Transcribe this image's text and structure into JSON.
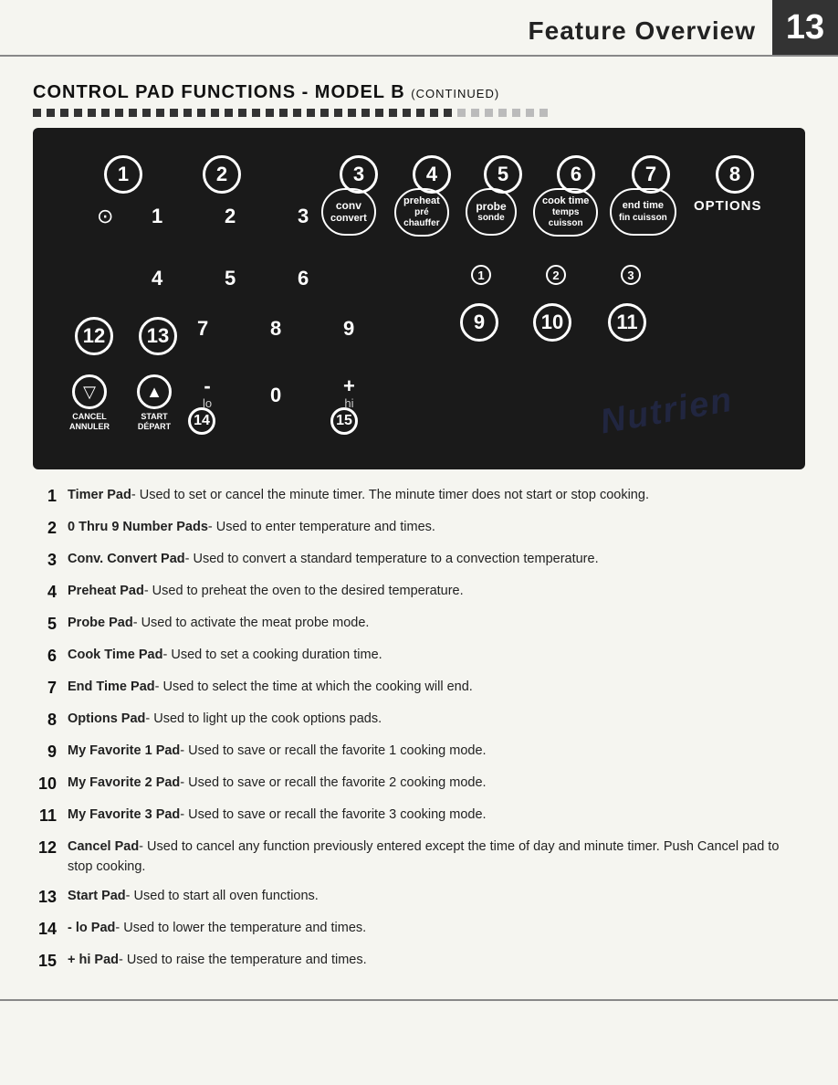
{
  "header": {
    "title": "Feature Overview",
    "page_num": "13"
  },
  "section": {
    "title": "CONTROL PAD FUNCTIONS - MODEL B",
    "continued": "(CONTINUED)"
  },
  "pad": {
    "circle_labels": [
      "1",
      "2",
      "3",
      "4",
      "5",
      "6",
      "7",
      "8"
    ],
    "number_keys": [
      "1",
      "2",
      "3",
      "4",
      "5",
      "6",
      "7",
      "8",
      "9",
      "0"
    ],
    "minus_label": "-\nlo",
    "plus_label": "+\nhi",
    "circle14": "14",
    "circle15": "15",
    "circle12": "12",
    "circle13": "13",
    "cancel_label": "CANCEL\nANNULER",
    "start_label": "START\nDÉPART",
    "func_buttons": [
      {
        "id": "3",
        "line1": "conv",
        "line2": "convert"
      },
      {
        "id": "4",
        "line1": "preheat",
        "line2": "pré",
        "line3": "chauffer"
      },
      {
        "id": "5",
        "line1": "probe",
        "line2": "sonde"
      },
      {
        "id": "6",
        "line1": "cook time",
        "line2": "temps",
        "line3": "cuisson"
      },
      {
        "id": "7",
        "line1": "end time",
        "line2": "fin cuisson"
      },
      {
        "id": "8",
        "line1": "OPTIONS",
        "line2": ""
      }
    ],
    "fav_nums": [
      "9",
      "10",
      "11"
    ],
    "fav_circles": [
      "1",
      "2",
      "3"
    ]
  },
  "descriptions": [
    {
      "num": "1",
      "text": "Timer Pad- Used to set or cancel the minute timer. The minute timer does not start or stop cooking."
    },
    {
      "num": "2",
      "text": "0 Thru 9 Number Pads- Used to enter temperature and times."
    },
    {
      "num": "3",
      "text": "Conv. Convert Pad- Used to convert a standard temperature to a convection temperature."
    },
    {
      "num": "4",
      "text": "Preheat Pad- Used to preheat the oven to the desired temperature."
    },
    {
      "num": "5",
      "text": "Probe Pad- Used to activate the meat probe mode."
    },
    {
      "num": "6",
      "text": "Cook Time Pad- Used to set a cooking duration time."
    },
    {
      "num": "7",
      "text": "End Time Pad- Used to select the time at which the cooking will end."
    },
    {
      "num": "8",
      "text": "Options Pad- Used to light up the cook options pads."
    },
    {
      "num": "9",
      "text": "My Favorite 1 Pad- Used to save or recall the favorite 1 cooking mode."
    },
    {
      "num": "10",
      "text": "My Favorite 2 Pad- Used to save or recall the favorite 2 cooking mode."
    },
    {
      "num": "11",
      "text": "My Favorite 3 Pad- Used to save or recall the favorite 3 cooking mode."
    },
    {
      "num": "12",
      "text": "Cancel Pad- Used to cancel any function previously entered except the time of day and minute timer. Push Cancel pad to stop cooking."
    },
    {
      "num": "13",
      "text": "Start Pad- Used to start all oven functions."
    },
    {
      "num": "14",
      "text": "- lo Pad- Used to lower the temperature and times."
    },
    {
      "num": "15",
      "text": "+ hi Pad- Used to raise the temperature and times."
    }
  ],
  "bold_parts": {
    "1": "Timer Pad",
    "2": "0 Thru 9 Number Pads",
    "3": "Conv. Convert Pad",
    "4": "Preheat Pad",
    "5": "Probe Pad",
    "6": "Cook Time Pad",
    "7": "End Time Pad",
    "8": "Options Pad",
    "9": "My Favorite 1 Pad",
    "10": "My Favorite 2 Pad",
    "11": "My Favorite 3 Pad",
    "12": "Cancel Pad",
    "13": "Start Pad",
    "14": "- lo Pad",
    "15": "+ hi Pad"
  }
}
